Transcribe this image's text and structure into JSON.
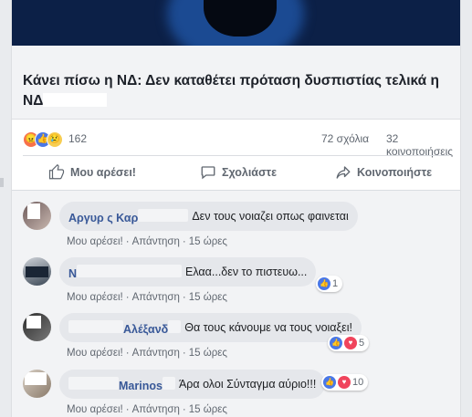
{
  "post": {
    "headline": "Κάνει πίσω η ΝΔ: Δεν καταθέτει πρόταση δυσπιστίας τελικά η ΝΔ",
    "reactions": {
      "count": "162",
      "icons": [
        "angry-icon",
        "like-icon",
        "sad-icon"
      ]
    },
    "comments_count": "72 σχόλια",
    "shares_count": "32 κοινοποιήσεις"
  },
  "actions": {
    "like": "Μου αρέσει!",
    "comment": "Σχολιάστε",
    "share": "Κοινοποιήστε"
  },
  "comments": [
    {
      "author_visible": "Αργυρ  ς Καρ",
      "text": "Δεν τους νοιαζει οπως φαινεται",
      "like": "Μου αρέσει!",
      "reply": "Απάντηση",
      "time": "15 ώρες",
      "reactions": null
    },
    {
      "author_visible": "Ν",
      "text": "Ελαα...δεν το πιστευω...",
      "like": "Μου αρέσει!",
      "reply": "Απάντηση",
      "time": "15 ώρες",
      "reactions": {
        "count": "1",
        "icons": [
          "like"
        ]
      }
    },
    {
      "author_visible": "Αλέξανδ",
      "text": "Θα τους κάνουμε να τους νοιαξει!",
      "like": "Μου αρέσει!",
      "reply": "Απάντηση",
      "time": "15 ώρες",
      "reactions": {
        "count": "5",
        "icons": [
          "like",
          "love"
        ]
      }
    },
    {
      "author_visible": "Marinos",
      "text": "Άρα ολοι Σύνταγμα αύριο!!!",
      "like": "Μου αρέσει!",
      "reply": "Απάντηση",
      "time": "15 ώρες",
      "reactions": {
        "count": "10",
        "icons": [
          "like",
          "love"
        ]
      }
    }
  ],
  "colors": {
    "link": "#385898",
    "meta": "#606770",
    "bg": "#e9ebee"
  }
}
